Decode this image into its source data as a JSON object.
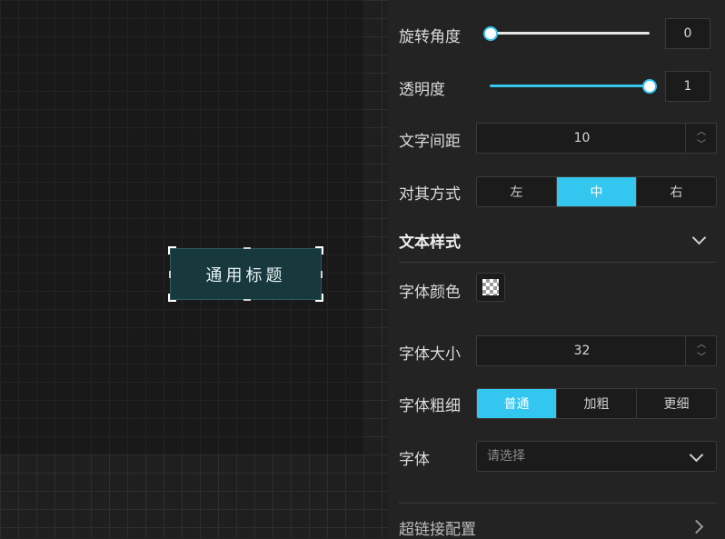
{
  "canvas": {
    "widget_text": "通用标题"
  },
  "panel": {
    "rotation": {
      "label": "旋转角度",
      "value": "0",
      "level": 0.0
    },
    "opacity": {
      "label": "透明度",
      "value": "1",
      "level": 1.0
    },
    "letter_spacing": {
      "label": "文字间距",
      "value": "10"
    },
    "align": {
      "label": "对其方式",
      "options": [
        "左",
        "中",
        "右"
      ],
      "selected": "中"
    },
    "text_style": {
      "title": "文本样式"
    },
    "font_color": {
      "label": "字体颜色"
    },
    "font_size": {
      "label": "字体大小",
      "value": "32"
    },
    "font_weight": {
      "label": "字体粗细",
      "options": [
        "普通",
        "加粗",
        "更细"
      ],
      "selected": "普通"
    },
    "font_family": {
      "label": "字体",
      "placeholder": "请选择"
    },
    "hyperlink": {
      "title": "超链接配置"
    }
  },
  "colors": {
    "accent": "#33c7ef",
    "panel_bg": "#232323",
    "widget_bg": "#17393e"
  }
}
